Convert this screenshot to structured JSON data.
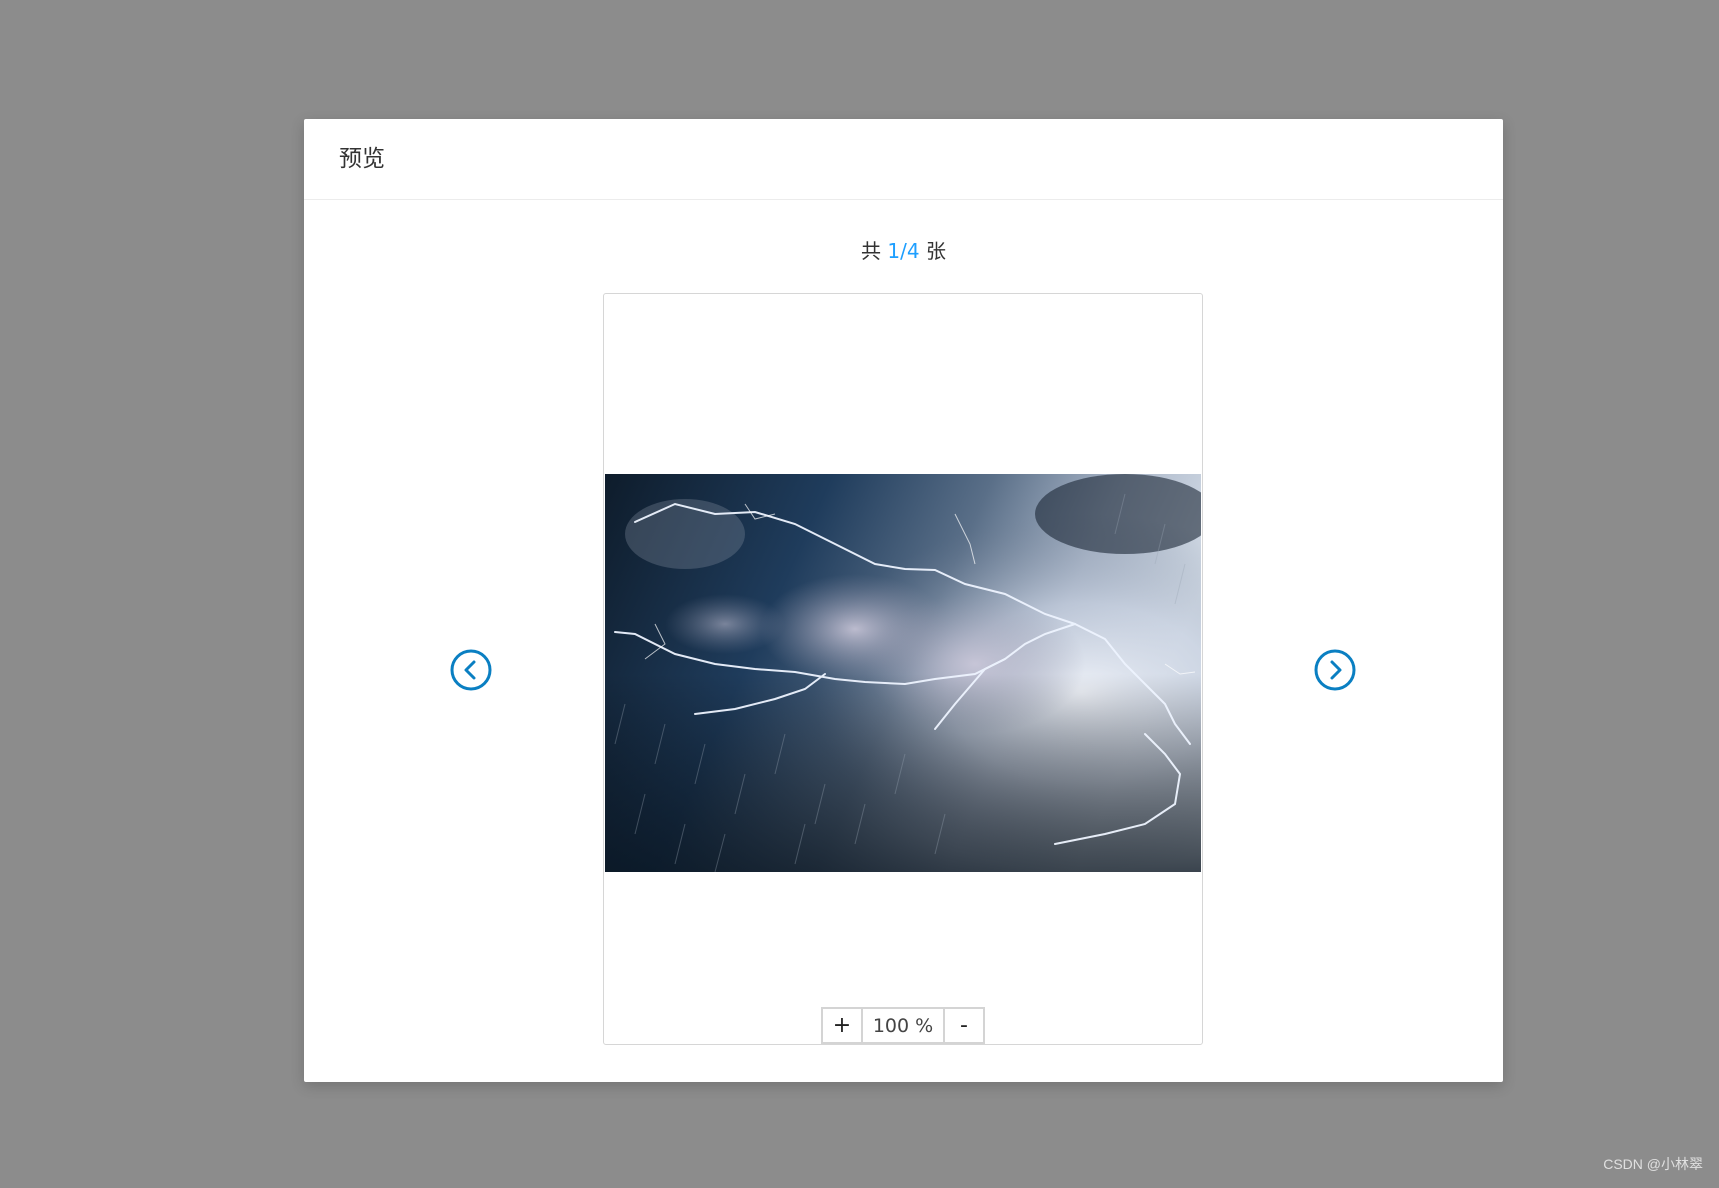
{
  "modal": {
    "title": "预览"
  },
  "counter": {
    "prefix": "共",
    "current": "1/4",
    "suffix": "张"
  },
  "viewer": {
    "image_subject": "lightning-storm-clouds",
    "prev_icon": "chevron-left-circle-icon",
    "next_icon": "chevron-right-circle-icon",
    "accent_color": "#0a7fc2"
  },
  "zoom": {
    "plus_label": "+",
    "value": "100 %",
    "minus_label": "-"
  },
  "watermark": {
    "text": "CSDN @小林翠"
  },
  "colors": {
    "overlay": "#8c8c8c",
    "counter_highlight": "#1e9fff"
  }
}
